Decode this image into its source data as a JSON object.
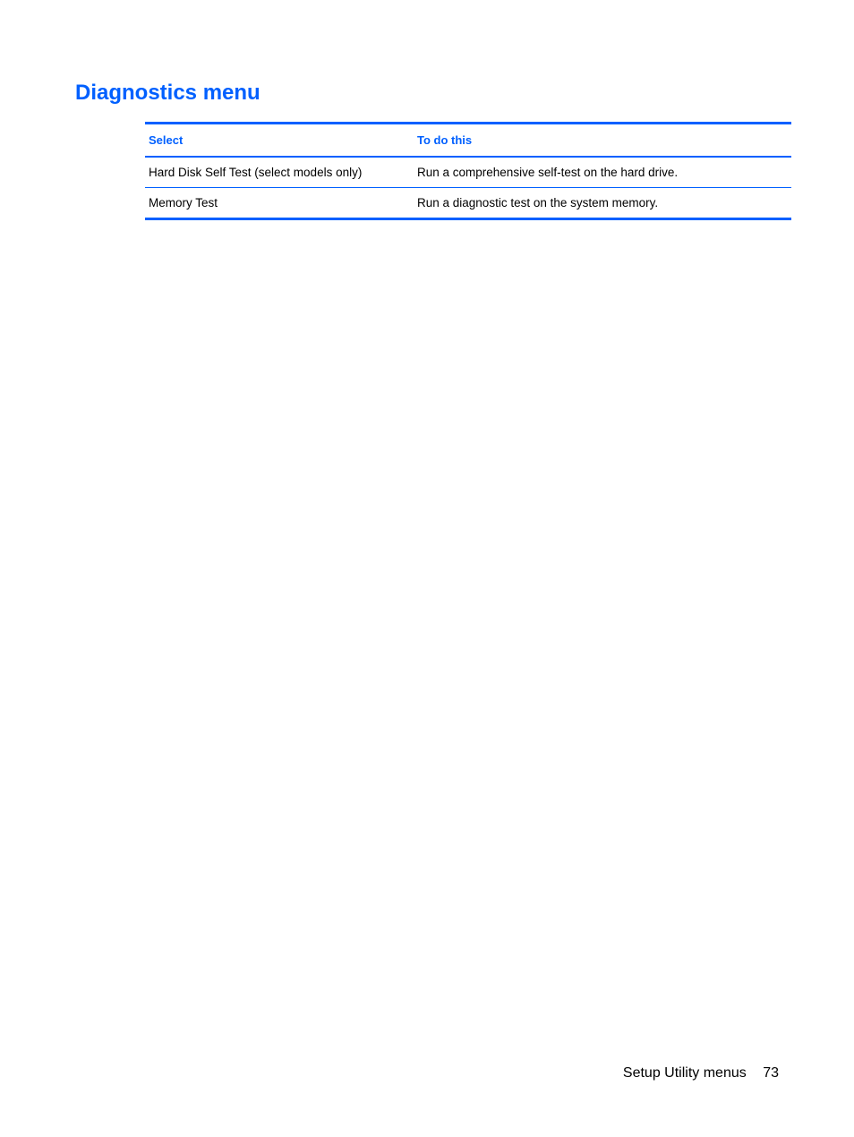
{
  "heading": "Diagnostics menu",
  "table": {
    "headers": {
      "select": "Select",
      "todo": "To do this"
    },
    "rows": [
      {
        "select": "Hard Disk Self Test (select models only)",
        "todo": "Run a comprehensive self-test on the hard drive."
      },
      {
        "select": "Memory Test",
        "todo": "Run a diagnostic test on the system memory."
      }
    ]
  },
  "footer": {
    "section": "Setup Utility menus",
    "page": "73"
  }
}
